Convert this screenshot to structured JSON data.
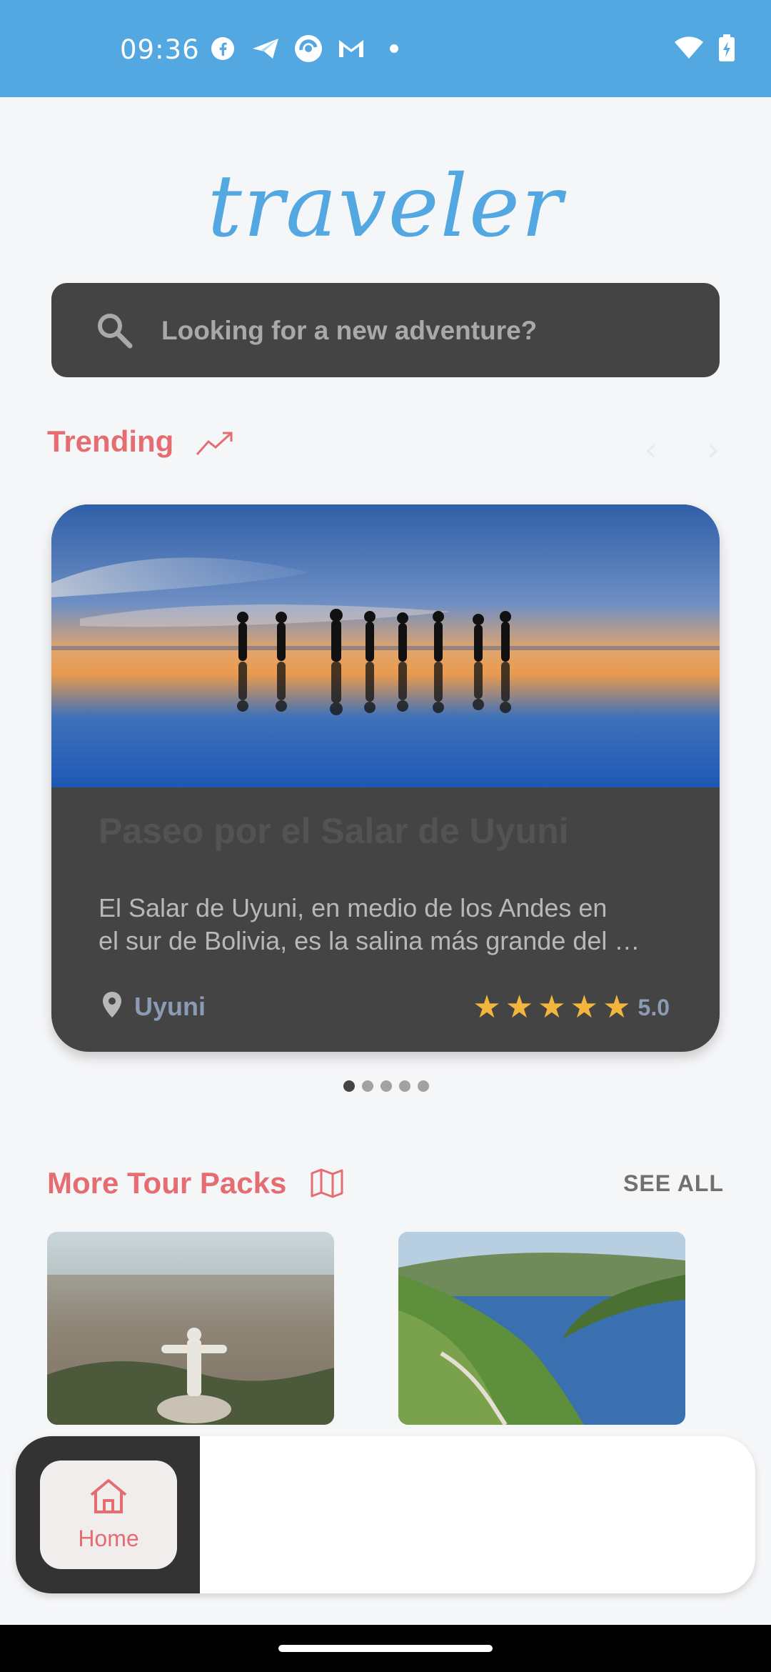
{
  "status_bar": {
    "time": "09:36",
    "left_icons": [
      "facebook-icon",
      "telegram-icon",
      "browser-icon",
      "gmail-icon",
      "dot-icon"
    ],
    "right_icons": [
      "wifi-icon",
      "battery-charging-icon"
    ],
    "color": "#53a8e2"
  },
  "header": {
    "logo": "traveler"
  },
  "search": {
    "placeholder": "Looking for a new adventure?"
  },
  "trending": {
    "title": "Trending",
    "icon": "trending-up-icon",
    "card": {
      "title": "Paseo por el Salar de Uyuni",
      "description_line1": "El Salar de Uyuni, en medio de los Andes en",
      "description_line2": "el sur de Bolivia, es la salina más grande del …",
      "location": "Uyuni",
      "rating": "5.0",
      "stars": 5
    },
    "carousel": {
      "total": 5,
      "active_index": 0
    }
  },
  "more_tours": {
    "title": "More Tour Packs",
    "icon": "map-icon",
    "see_all": "SEE ALL"
  },
  "bottom_nav": {
    "items": [
      {
        "label": "Home",
        "icon": "home-icon",
        "active": true
      }
    ]
  },
  "colors": {
    "accent": "#e56d72",
    "brand_blue": "#53a8e2",
    "dark_surface": "#444444",
    "star": "#f2b53d"
  }
}
